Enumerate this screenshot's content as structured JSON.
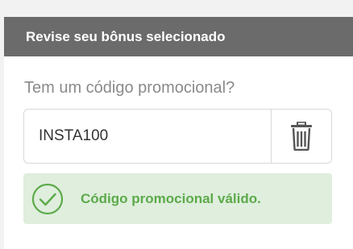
{
  "panel": {
    "title": "Revise seu bônus selecionado"
  },
  "promo": {
    "label": "Tem um código promocional?",
    "code_value": "INSTA100",
    "remove_icon": "trash-icon",
    "status_icon": "check-circle-icon",
    "status_message": "Código promocional válido."
  },
  "colors": {
    "header_bg": "#6b6b6b",
    "success_bg": "#dfeedd",
    "success_text": "#5caa4a"
  }
}
